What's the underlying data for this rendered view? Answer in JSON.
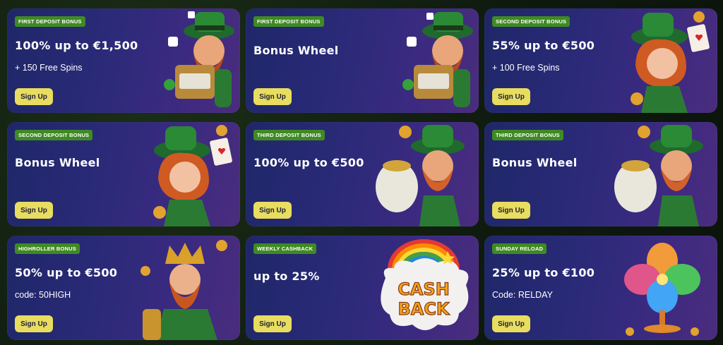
{
  "cards": [
    {
      "badge": "FIRST DEPOSIT BONUS",
      "title": "100% up to €1,500",
      "sub": "+ 150 Free Spins",
      "button": "Sign Up",
      "art": "leprechaun-slot-machine-icon"
    },
    {
      "badge": "FIRST DEPOSIT BONUS",
      "title": "Bonus Wheel",
      "sub": "",
      "button": "Sign Up",
      "art": "leprechaun-slot-machine-icon"
    },
    {
      "badge": "SECOND DEPOSIT BONUS",
      "title": "55% up to €500",
      "sub": "+ 100 Free Spins",
      "button": "Sign Up",
      "art": "redhead-lady-card-icon"
    },
    {
      "badge": "SECOND DEPOSIT BONUS",
      "title": "Bonus Wheel",
      "sub": "",
      "button": "Sign Up",
      "art": "redhead-lady-card-icon"
    },
    {
      "badge": "THIRD DEPOSIT BONUS",
      "title": "100% up to €500",
      "sub": "",
      "button": "Sign Up",
      "art": "leprechaun-gold-sack-icon"
    },
    {
      "badge": "THIRD DEPOSIT BONUS",
      "title": "Bonus Wheel",
      "sub": "",
      "button": "Sign Up",
      "art": "leprechaun-gold-sack-icon"
    },
    {
      "badge": "HIGHROLLER BONUS",
      "title": "50% up to €500",
      "sub": "code: 50HIGH",
      "button": "Sign Up",
      "art": "leprechaun-king-icon"
    },
    {
      "badge": "WEEKLY CASHBACK",
      "title": "up to 25%",
      "sub": "",
      "button": "Sign Up",
      "art": "cash-back-rainbow-icon"
    },
    {
      "badge": "SUNDAY RELOAD",
      "title": "25% up to €100",
      "sub": "Code: RELDAY",
      "button": "Sign Up",
      "art": "rainbow-clover-icon"
    }
  ],
  "art_text": {
    "cash": "CASH",
    "back": "BACK"
  },
  "colors": {
    "badge": "#3f8a23",
    "button": "#e8dd5f",
    "card_bg": "#2a2a78",
    "page_bg": "#122012"
  }
}
